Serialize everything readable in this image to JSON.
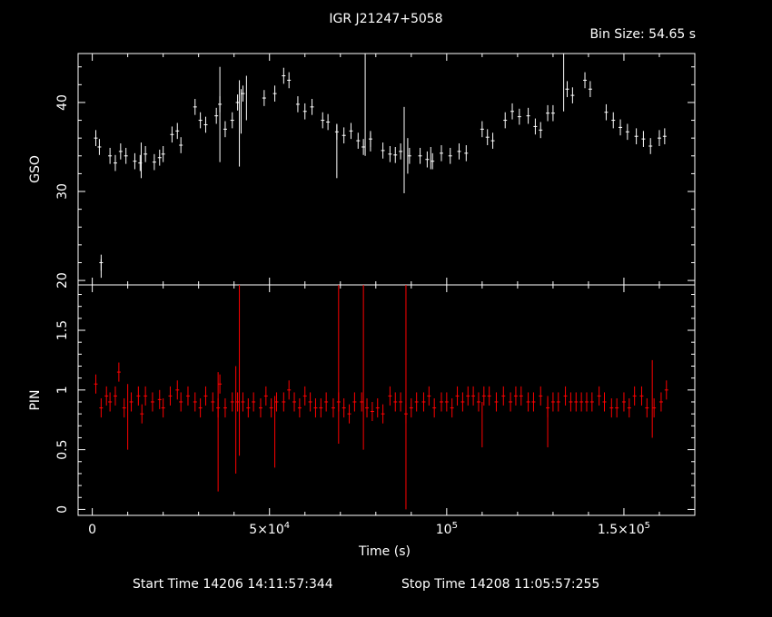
{
  "header": {
    "title": "IGR J21247+5058",
    "bin_size": "Bin Size: 54.65 s"
  },
  "footer": {
    "start_time": "Start Time 14206 14:11:57:344",
    "stop_time": "Stop Time 14208 11:05:57:255"
  },
  "colors": {
    "background": "#000000",
    "axes": "#ffffff",
    "gso": "#ffffff",
    "pin": "#ff0000"
  },
  "chart_data": [
    {
      "type": "scatter",
      "panel": "top",
      "ylabel": "GSO",
      "xlim": [
        -4000,
        170000
      ],
      "ylim": [
        19.5,
        45.5
      ],
      "yticks": [
        20,
        30,
        40
      ],
      "ytick_labels": [
        "20",
        "30",
        "40"
      ],
      "grid": false,
      "series": [
        {
          "color": "#ffffff",
          "points": [
            [
              1000,
              36.0
            ],
            [
              2000,
              35.0
            ],
            [
              2500,
              22.0
            ],
            [
              5000,
              34.0
            ],
            [
              6500,
              33.2
            ],
            [
              8000,
              34.5
            ],
            [
              9500,
              34.0
            ],
            [
              12000,
              33.4
            ],
            [
              13500,
              33.2
            ],
            [
              15000,
              34.2
            ],
            [
              17500,
              33.3
            ],
            [
              19000,
              33.8
            ],
            [
              20000,
              34.2
            ],
            [
              22500,
              36.4
            ],
            [
              24000,
              36.8
            ],
            [
              25000,
              35.2
            ],
            [
              29000,
              39.5
            ],
            [
              30500,
              38.0
            ],
            [
              32000,
              37.5
            ],
            [
              35000,
              38.5
            ],
            [
              36000,
              39.8
            ],
            [
              37500,
              37.0
            ],
            [
              39500,
              38.0
            ],
            [
              41000,
              40.0
            ],
            [
              42500,
              41.0
            ],
            [
              48500,
              40.5
            ],
            [
              51500,
              41.0
            ],
            [
              54000,
              43.0
            ],
            [
              55500,
              42.5
            ],
            [
              58000,
              39.8
            ],
            [
              60000,
              39.0
            ],
            [
              62000,
              39.5
            ],
            [
              65000,
              38.0
            ],
            [
              66500,
              37.8
            ],
            [
              69000,
              36.7
            ],
            [
              71000,
              36.3
            ],
            [
              73000,
              36.8
            ],
            [
              75000,
              35.7
            ],
            [
              76500,
              35.0
            ],
            [
              78500,
              35.9
            ],
            [
              82000,
              34.6
            ],
            [
              84000,
              34.2
            ],
            [
              85500,
              34.1
            ],
            [
              87000,
              34.5
            ],
            [
              89500,
              34.0
            ],
            [
              92500,
              34.0
            ],
            [
              94500,
              33.6
            ],
            [
              96000,
              33.4
            ],
            [
              98500,
              34.3
            ],
            [
              101000,
              34.0
            ],
            [
              103500,
              34.5
            ],
            [
              105500,
              34.3
            ],
            [
              110000,
              37.0
            ],
            [
              111500,
              36.1
            ],
            [
              113000,
              35.7
            ],
            [
              116500,
              38.0
            ],
            [
              118500,
              39.0
            ],
            [
              120500,
              38.4
            ],
            [
              123000,
              38.5
            ],
            [
              125000,
              37.3
            ],
            [
              126500,
              36.9
            ],
            [
              128500,
              38.8
            ],
            [
              130000,
              38.8
            ],
            [
              134000,
              41.5
            ],
            [
              135500,
              40.8
            ],
            [
              139000,
              42.5
            ],
            [
              140500,
              41.5
            ],
            [
              145000,
              38.9
            ],
            [
              147000,
              38.0
            ],
            [
              149000,
              37.2
            ],
            [
              151000,
              36.7
            ],
            [
              153500,
              36.2
            ],
            [
              155500,
              35.9
            ],
            [
              157500,
              35.1
            ],
            [
              160000,
              36.0
            ],
            [
              161500,
              36.2
            ]
          ],
          "errorbar_extremes": [
            [
              2500,
              20.3,
              22.4
            ],
            [
              13800,
              31.5,
              35.5
            ],
            [
              36000,
              33.3,
              44.0
            ],
            [
              41500,
              32.8,
              42.5
            ],
            [
              42000,
              36.5,
              41.5
            ],
            [
              43500,
              38.0,
              43.0
            ],
            [
              69000,
              31.5,
              37.5
            ],
            [
              77000,
              34.0,
              45.5
            ],
            [
              78500,
              34.5,
              36.6
            ],
            [
              88000,
              29.8,
              39.5
            ],
            [
              89000,
              32.0,
              36.0
            ],
            [
              95500,
              32.5,
              35.0
            ],
            [
              133000,
              39.0,
              45.5
            ]
          ]
        }
      ]
    },
    {
      "type": "scatter",
      "panel": "bottom",
      "xlabel": "Time (s)",
      "ylabel": "PIN",
      "xlim": [
        -4000,
        170000
      ],
      "ylim": [
        -0.05,
        1.88
      ],
      "xticks": [
        0,
        50000,
        100000,
        150000
      ],
      "yticks": [
        0,
        0.5,
        1,
        1.5
      ],
      "ytick_labels": [
        "0",
        "0.5",
        "1",
        "1.5"
      ],
      "grid": false,
      "series": [
        {
          "color": "#ff0000",
          "points": [
            [
              1000,
              1.05
            ],
            [
              2500,
              0.85
            ],
            [
              4000,
              0.95
            ],
            [
              5000,
              0.9
            ],
            [
              6500,
              0.95
            ],
            [
              7500,
              1.15
            ],
            [
              9000,
              0.85
            ],
            [
              11000,
              0.9
            ],
            [
              13000,
              0.95
            ],
            [
              14000,
              0.8
            ],
            [
              15000,
              0.95
            ],
            [
              17000,
              0.9
            ],
            [
              19000,
              0.92
            ],
            [
              20000,
              0.85
            ],
            [
              22000,
              0.95
            ],
            [
              24000,
              1.0
            ],
            [
              25000,
              0.9
            ],
            [
              27000,
              0.95
            ],
            [
              29000,
              0.9
            ],
            [
              30500,
              0.85
            ],
            [
              32000,
              0.95
            ],
            [
              34000,
              0.9
            ],
            [
              35500,
              0.85
            ],
            [
              36000,
              1.05
            ],
            [
              37500,
              0.85
            ],
            [
              39500,
              0.9
            ],
            [
              41000,
              0.9
            ],
            [
              42500,
              0.9
            ],
            [
              44000,
              0.85
            ],
            [
              45500,
              0.9
            ],
            [
              47500,
              0.85
            ],
            [
              49000,
              0.95
            ],
            [
              50500,
              0.85
            ],
            [
              52000,
              0.9
            ],
            [
              54000,
              0.9
            ],
            [
              55500,
              1.0
            ],
            [
              57000,
              0.9
            ],
            [
              58500,
              0.85
            ],
            [
              60000,
              0.95
            ],
            [
              61500,
              0.9
            ],
            [
              63000,
              0.85
            ],
            [
              64500,
              0.85
            ],
            [
              66000,
              0.9
            ],
            [
              68000,
              0.85
            ],
            [
              69500,
              0.9
            ],
            [
              71000,
              0.85
            ],
            [
              72500,
              0.8
            ],
            [
              74000,
              0.9
            ],
            [
              76000,
              0.9
            ],
            [
              77500,
              0.85
            ],
            [
              79000,
              0.82
            ],
            [
              80500,
              0.85
            ],
            [
              82000,
              0.8
            ],
            [
              84000,
              0.95
            ],
            [
              85500,
              0.9
            ],
            [
              87000,
              0.9
            ],
            [
              88500,
              0.8
            ],
            [
              90000,
              0.85
            ],
            [
              91500,
              0.9
            ],
            [
              93500,
              0.9
            ],
            [
              95000,
              0.95
            ],
            [
              96500,
              0.85
            ],
            [
              98500,
              0.9
            ],
            [
              100000,
              0.9
            ],
            [
              101500,
              0.85
            ],
            [
              103000,
              0.95
            ],
            [
              104500,
              0.9
            ],
            [
              106000,
              0.95
            ],
            [
              107500,
              0.95
            ],
            [
              109000,
              0.9
            ],
            [
              110500,
              0.95
            ],
            [
              112000,
              0.95
            ],
            [
              114000,
              0.9
            ],
            [
              116000,
              0.95
            ],
            [
              118000,
              0.9
            ],
            [
              119500,
              0.95
            ],
            [
              121000,
              0.95
            ],
            [
              123000,
              0.9
            ],
            [
              124500,
              0.9
            ],
            [
              126500,
              0.95
            ],
            [
              128500,
              0.85
            ],
            [
              130000,
              0.9
            ],
            [
              131500,
              0.9
            ],
            [
              133500,
              0.95
            ],
            [
              135000,
              0.9
            ],
            [
              136500,
              0.9
            ],
            [
              138000,
              0.9
            ],
            [
              139500,
              0.9
            ],
            [
              141000,
              0.9
            ],
            [
              143000,
              0.95
            ],
            [
              144500,
              0.9
            ],
            [
              146500,
              0.85
            ],
            [
              148000,
              0.85
            ],
            [
              150000,
              0.9
            ],
            [
              151500,
              0.85
            ],
            [
              153000,
              0.95
            ],
            [
              155000,
              0.95
            ],
            [
              156500,
              0.85
            ],
            [
              158500,
              0.85
            ],
            [
              160500,
              0.9
            ],
            [
              162000,
              1.0
            ]
          ],
          "errorbar_extremes": [
            [
              10000,
              0.5,
              1.05
            ],
            [
              35500,
              0.15,
              1.15
            ],
            [
              40500,
              0.3,
              1.2
            ],
            [
              41500,
              0.45,
              1.9
            ],
            [
              51500,
              0.35,
              0.95
            ],
            [
              69500,
              0.55,
              1.9
            ],
            [
              76500,
              0.5,
              1.9
            ],
            [
              88500,
              0.0,
              1.9
            ],
            [
              110000,
              0.52,
              0.9
            ],
            [
              128500,
              0.52,
              0.95
            ],
            [
              158000,
              0.6,
              1.25
            ]
          ]
        }
      ]
    }
  ]
}
